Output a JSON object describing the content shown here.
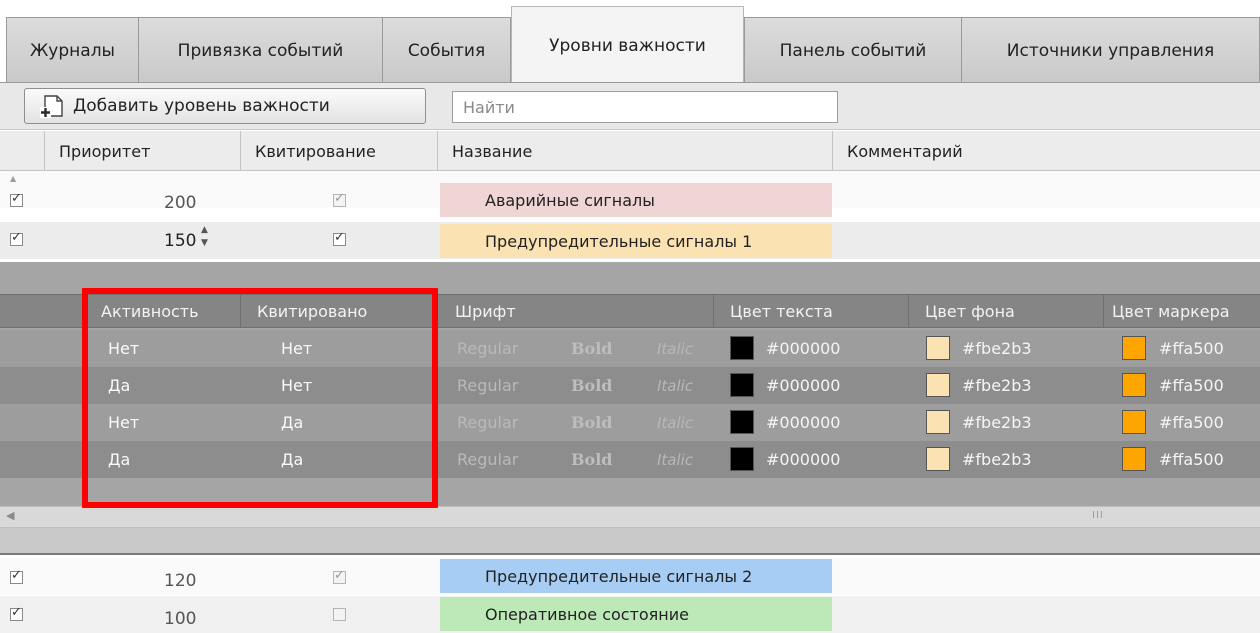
{
  "tabs": [
    {
      "label": "Журналы",
      "active": false
    },
    {
      "label": "Привязка событий",
      "active": false
    },
    {
      "label": "События",
      "active": false
    },
    {
      "label": "Уровни важности",
      "active": true
    },
    {
      "label": "Панель событий",
      "active": false
    },
    {
      "label": "Источники управления",
      "active": false
    }
  ],
  "toolbar": {
    "add_label": "Добавить уровень важности",
    "search_placeholder": "Найти"
  },
  "columns": {
    "priority": "Приоритет",
    "ack": "Квитирование",
    "name": "Название",
    "comment": "Комментарий"
  },
  "rows": [
    {
      "enabled": true,
      "priority": "200",
      "ack": true,
      "name": "Аварийные сигналы",
      "color": "#f0d5d5"
    },
    {
      "enabled": true,
      "priority": "150",
      "ack": true,
      "name": "Предупредительные сигналы 1",
      "color": "#fbe2b3"
    },
    {
      "enabled": true,
      "priority": "120",
      "ack": true,
      "name": "Предупредительные сигналы 2",
      "color": "#a8cdf5"
    },
    {
      "enabled": true,
      "priority": "100",
      "ack": false,
      "name": "Оперативное состояние",
      "color": "#bde8b8"
    }
  ],
  "detail": {
    "columns": {
      "active": "Активность",
      "acked": "Квитировано",
      "font": "Шрифт",
      "text_color": "Цвет текста",
      "bg_color": "Цвет фона",
      "marker_color": "Цвет маркера"
    },
    "font_options": {
      "regular": "Regular",
      "bold": "Bold",
      "italic": "Italic"
    },
    "scroll_grip": "III",
    "rows": [
      {
        "active": "Нет",
        "acked": "Нет",
        "text_color": "#000000",
        "bg_color": "#fbe2b3",
        "marker_color": "#ffa500"
      },
      {
        "active": "Да",
        "acked": "Нет",
        "text_color": "#000000",
        "bg_color": "#fbe2b3",
        "marker_color": "#ffa500"
      },
      {
        "active": "Нет",
        "acked": "Да",
        "text_color": "#000000",
        "bg_color": "#fbe2b3",
        "marker_color": "#ffa500"
      },
      {
        "active": "Да",
        "acked": "Да",
        "text_color": "#000000",
        "bg_color": "#fbe2b3",
        "marker_color": "#ffa500"
      }
    ]
  },
  "spinner_up": "▲",
  "spinner_down": "▼"
}
